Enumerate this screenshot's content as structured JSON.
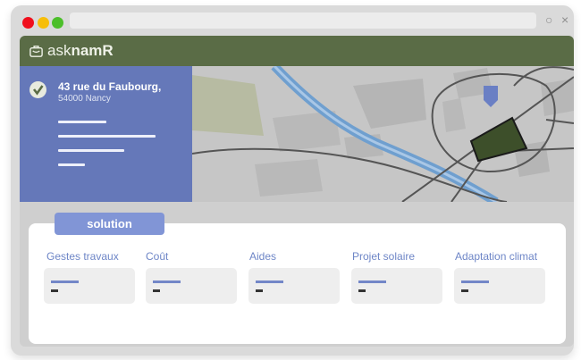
{
  "browser": {
    "controls": {
      "reload": "○",
      "close": "×"
    }
  },
  "app": {
    "logo": {
      "prefix": "ask",
      "suffix": "namR"
    }
  },
  "address": {
    "line1": "43 rue du Faubourg,",
    "line2": "54000 Nancy"
  },
  "solution_tab": "solution",
  "categories": [
    "Gestes travaux",
    "Coût",
    "Aides",
    "Projet solaire",
    "Adaptation climat"
  ],
  "colors": {
    "appbar": "#5a6c46",
    "panel": "#6578b9",
    "accent": "#8195d6",
    "building": "#3d4f2a",
    "river": "#6f9fcf"
  },
  "icons": {
    "logo": "suitcase-icon",
    "check": "check-circle-icon",
    "pin": "map-pin-icon"
  }
}
